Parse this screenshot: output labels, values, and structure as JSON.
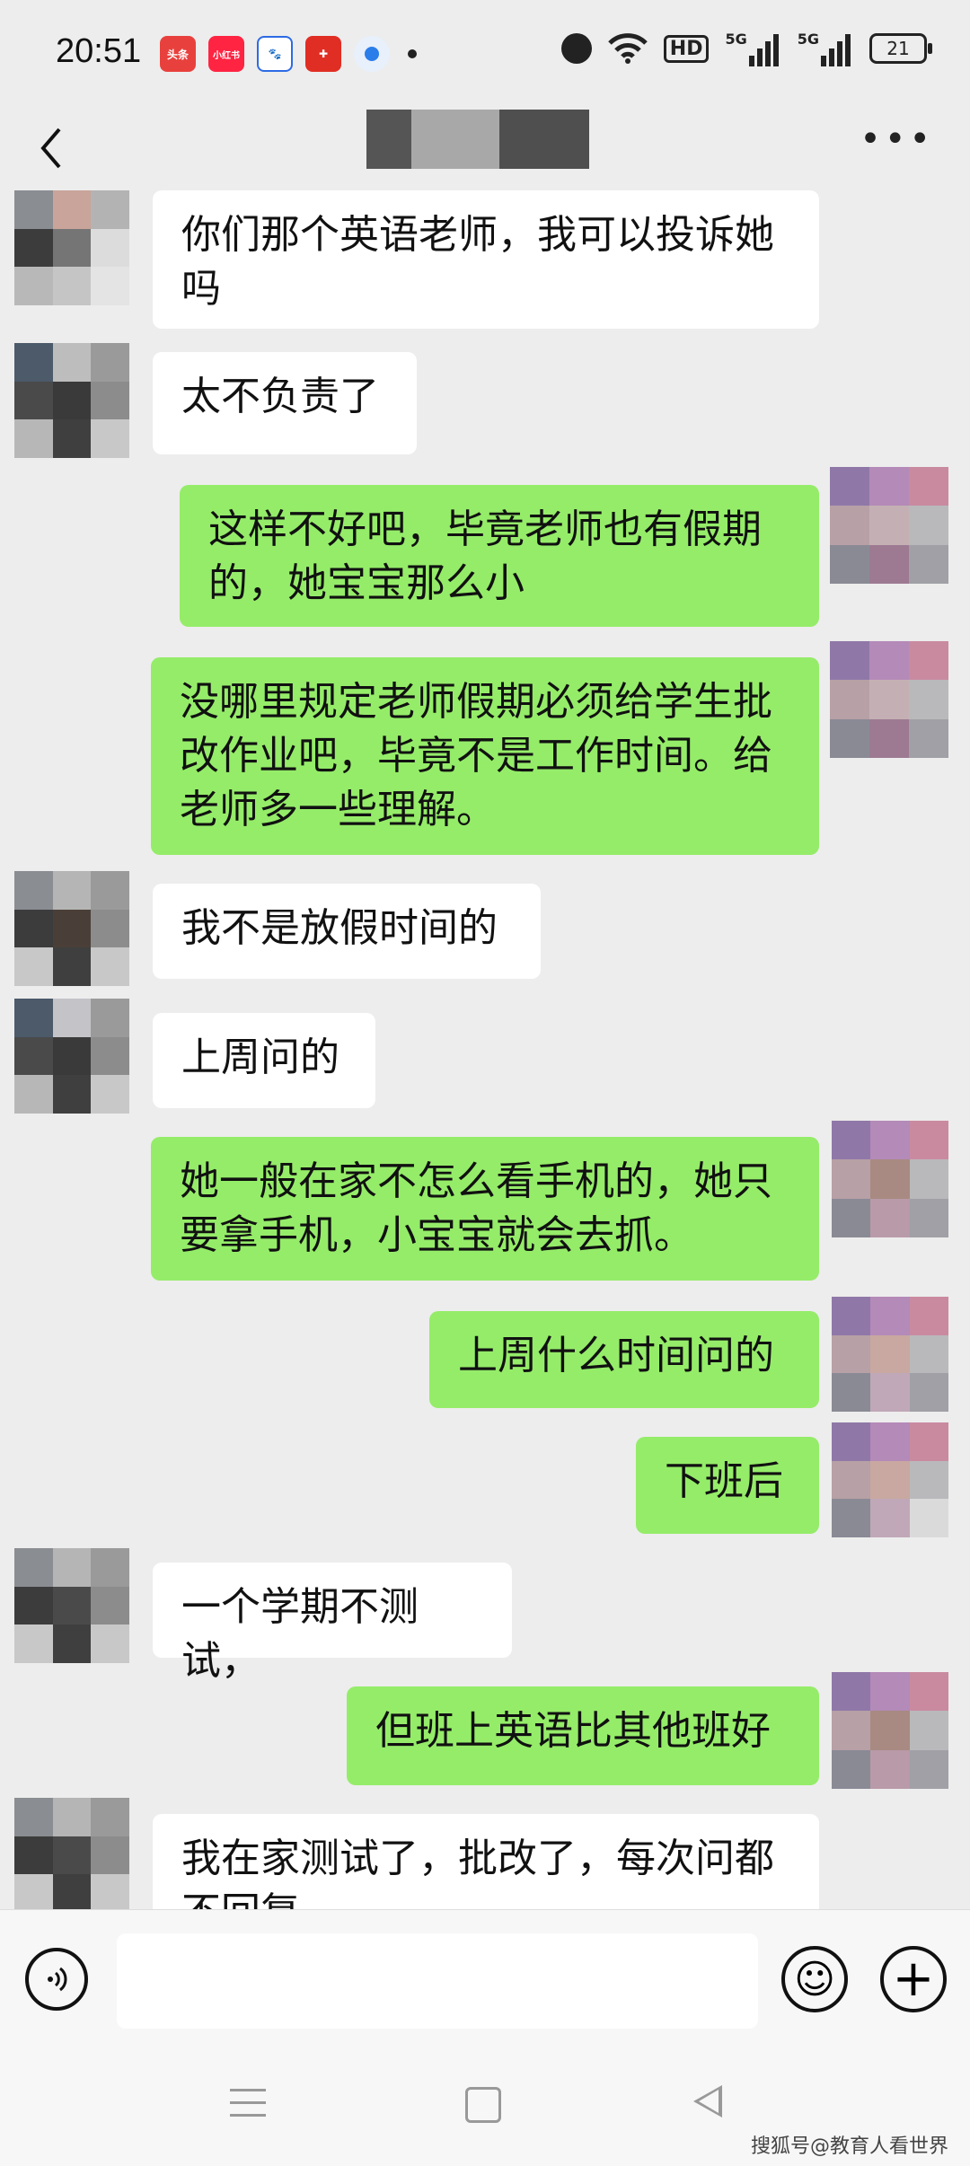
{
  "status_bar": {
    "time": "20:51",
    "app_icons": [
      {
        "name": "toutiao-icon",
        "label": "头条",
        "color": "#e8413d"
      },
      {
        "name": "xiaohongshu-icon",
        "label": "小红书",
        "color": "#ff2442"
      },
      {
        "name": "baidu-icon",
        "label": "",
        "color": "#2d6be4"
      },
      {
        "name": "pinduoduo-icon",
        "label": "",
        "color": "#e02e24"
      },
      {
        "name": "circle-app-icon",
        "label": "",
        "color": "#2b7de9"
      }
    ],
    "hd_label": "HD",
    "signal_label_1": "5G",
    "signal_label_2": "5G",
    "battery": "21"
  },
  "nav": {
    "more_label": "•••"
  },
  "messages": [
    {
      "side": "in",
      "text": "你们那个英语老师，我可以投诉她吗"
    },
    {
      "side": "in",
      "text": "太不负责了"
    },
    {
      "side": "out",
      "text": "这样不好吧，毕竟老师也有假期的，她宝宝那么小"
    },
    {
      "side": "out",
      "text": "没哪里规定老师假期必须给学生批改作业吧，毕竟不是工作时间。给老师多一些理解。"
    },
    {
      "side": "in",
      "text": "我不是放假时间的"
    },
    {
      "side": "in",
      "text": "上周问的"
    },
    {
      "side": "out",
      "text": "她一般在家不怎么看手机的，她只要拿手机，小宝宝就会去抓。"
    },
    {
      "side": "out",
      "text": "上周什么时间问的"
    },
    {
      "side": "out",
      "text": "下班后"
    },
    {
      "side": "in",
      "text": "一个学期不测试，"
    },
    {
      "side": "out",
      "text": "但班上英语比其他班好"
    },
    {
      "side": "in",
      "text": "我在家测试了，批改了，每次问都不回复"
    }
  ],
  "input_bar": {
    "placeholder": "",
    "emoji_glyph": "☺",
    "plus_glyph": "+"
  },
  "watermark": "搜狐号@教育人看世界",
  "colors": {
    "background": "#ededed",
    "bubble_in": "#ffffff",
    "bubble_out": "#95ec69"
  }
}
